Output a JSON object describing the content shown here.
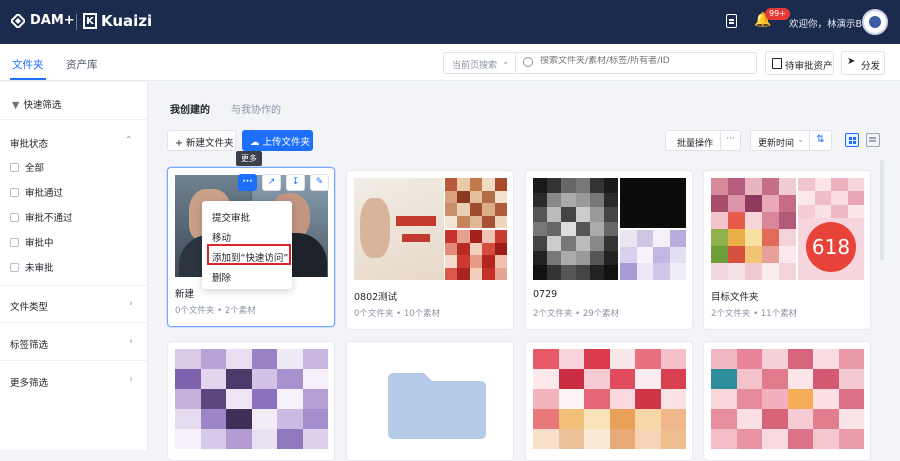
{
  "topbar": {
    "logo_dam": "DAM+",
    "logo_kuaizi": "Kuaizi",
    "notif_badge": "99+",
    "welcome": "欢迎你，林演示B"
  },
  "subbar": {
    "tabs": [
      "文件夹",
      "资产库"
    ],
    "search_scope": "当前页搜索",
    "search_placeholder": "搜索文件夹/素材/标签/所有者/ID",
    "pending_label": "待审批资产",
    "share_label": "分发"
  },
  "sidebar": {
    "quick_filter": "快速筛选",
    "approval_title": "审批状态",
    "approval_items": [
      "全部",
      "审批通过",
      "审批不通过",
      "审批中",
      "未审批"
    ],
    "sections": [
      "文件类型",
      "标签筛选",
      "更多筛选"
    ]
  },
  "main": {
    "tabs": [
      "我创建的",
      "与我协作的"
    ],
    "new_folder": "新建文件夹",
    "upload_folder": "上传文件夹",
    "tooltip_more": "更多",
    "batch": "批量操作",
    "more_dots": "···",
    "sort": "更新时间",
    "menu": [
      "提交审批",
      "移动",
      "添加到“快速访问”",
      "删除"
    ],
    "cards": [
      {
        "name": "新建",
        "meta": "0个文件夹 • 2个素材"
      },
      {
        "name": "0802测试",
        "meta": "0个文件夹 • 10个素材"
      },
      {
        "name": "0729",
        "meta": "2个文件夹 • 29个素材"
      },
      {
        "name": "目标文件夹",
        "meta": "2个文件夹 • 11个素材"
      }
    ],
    "thumb_text_618": "618"
  },
  "colors": {
    "topbar_bg": "#1b2b4d",
    "accent": "#1f6fff",
    "highlight_red": "#d8262b"
  }
}
